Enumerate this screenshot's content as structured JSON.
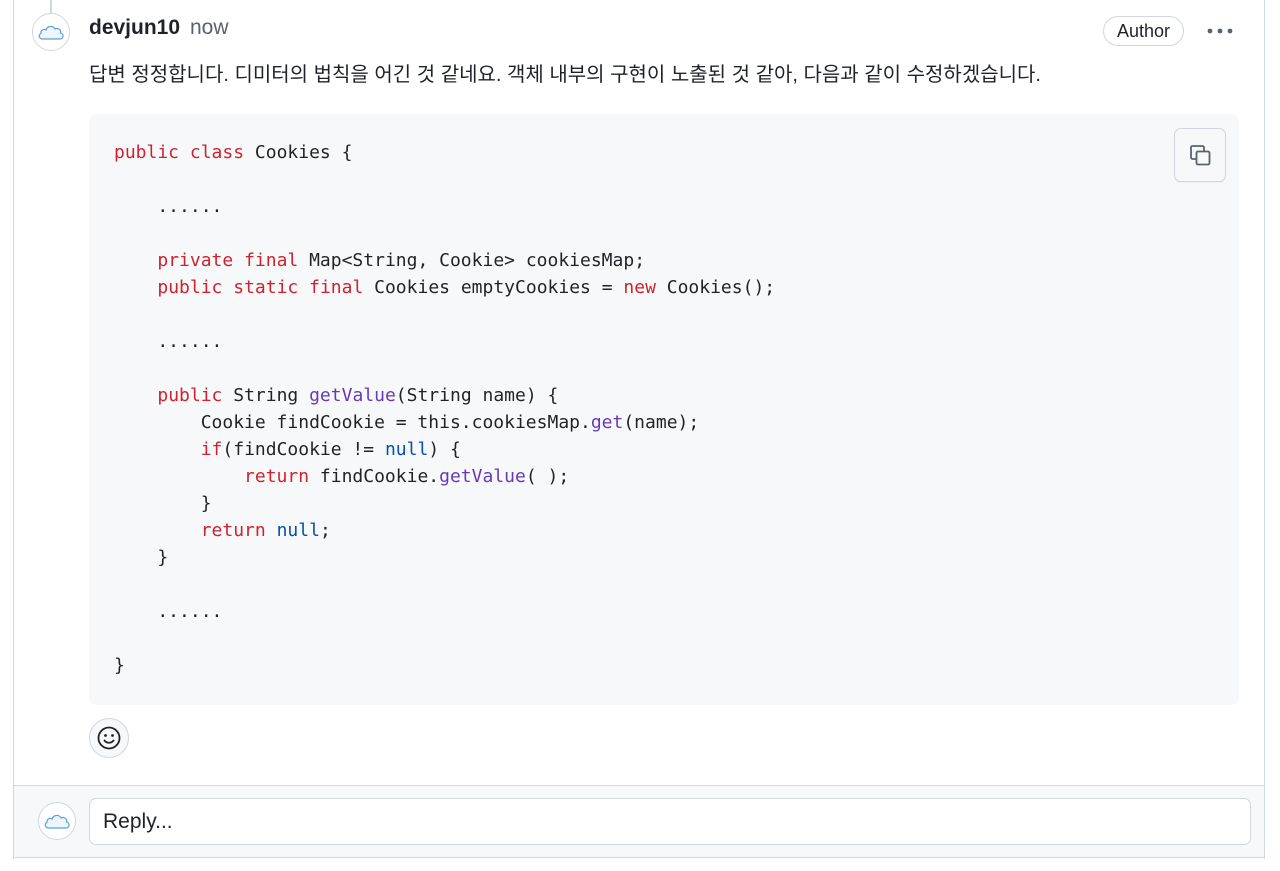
{
  "comment": {
    "author": "devjun10",
    "time": "now",
    "badge": "Author",
    "body": "답변 정정합니다. 디미터의 법칙을 어긴 것 같네요. 객체 내부의 구현이 노출된 것 같아, 다음과 같이 수정하겠습니다.",
    "avatar_icon": "cloud-icon",
    "more_icon": "kebab-horizontal-icon"
  },
  "code": {
    "language": "java",
    "copy_icon": "copy-icon",
    "lines": [
      [
        [
          "kw",
          "public"
        ],
        [
          "p",
          " "
        ],
        [
          "kw",
          "class"
        ],
        [
          "p",
          " Cookies {"
        ]
      ],
      [],
      [
        [
          "p",
          "    ......"
        ]
      ],
      [],
      [
        [
          "p",
          "    "
        ],
        [
          "kw",
          "private"
        ],
        [
          "p",
          " "
        ],
        [
          "kw",
          "final"
        ],
        [
          "p",
          " Map<String, Cookie> cookiesMap;"
        ]
      ],
      [
        [
          "p",
          "    "
        ],
        [
          "kw",
          "public"
        ],
        [
          "p",
          " "
        ],
        [
          "kw",
          "static"
        ],
        [
          "p",
          " "
        ],
        [
          "kw",
          "final"
        ],
        [
          "p",
          " Cookies emptyCookies = "
        ],
        [
          "kw",
          "new"
        ],
        [
          "p",
          " Cookies();"
        ]
      ],
      [],
      [
        [
          "p",
          "    ......"
        ]
      ],
      [],
      [
        [
          "p",
          "    "
        ],
        [
          "kw",
          "public"
        ],
        [
          "p",
          " String "
        ],
        [
          "fn",
          "getValue"
        ],
        [
          "p",
          "(String name) {"
        ]
      ],
      [
        [
          "p",
          "        Cookie findCookie = this.cookiesMap."
        ],
        [
          "fn",
          "get"
        ],
        [
          "p",
          "(name);"
        ]
      ],
      [
        [
          "p",
          "        "
        ],
        [
          "kw",
          "if"
        ],
        [
          "p",
          "(findCookie != "
        ],
        [
          "lit",
          "null"
        ],
        [
          "p",
          ") {"
        ]
      ],
      [
        [
          "p",
          "            "
        ],
        [
          "kw",
          "return"
        ],
        [
          "p",
          " findCookie."
        ],
        [
          "fn",
          "getValue"
        ],
        [
          "p",
          "( );"
        ]
      ],
      [
        [
          "p",
          "        }"
        ]
      ],
      [
        [
          "p",
          "        "
        ],
        [
          "kw",
          "return"
        ],
        [
          "p",
          " "
        ],
        [
          "lit",
          "null"
        ],
        [
          "p",
          ";"
        ]
      ],
      [
        [
          "p",
          "    }"
        ]
      ],
      [],
      [
        [
          "p",
          "    ......"
        ]
      ],
      [],
      [
        [
          "p",
          "}"
        ]
      ]
    ]
  },
  "reactions": {
    "icon": "smiley-icon"
  },
  "reply": {
    "placeholder": "Reply...",
    "avatar_icon": "cloud-icon"
  },
  "colors": {
    "keyword": "#cf222e",
    "function": "#6639ba",
    "literal": "#0550ae",
    "code_background": "#f6f8fa",
    "border": "#d0d7de"
  }
}
